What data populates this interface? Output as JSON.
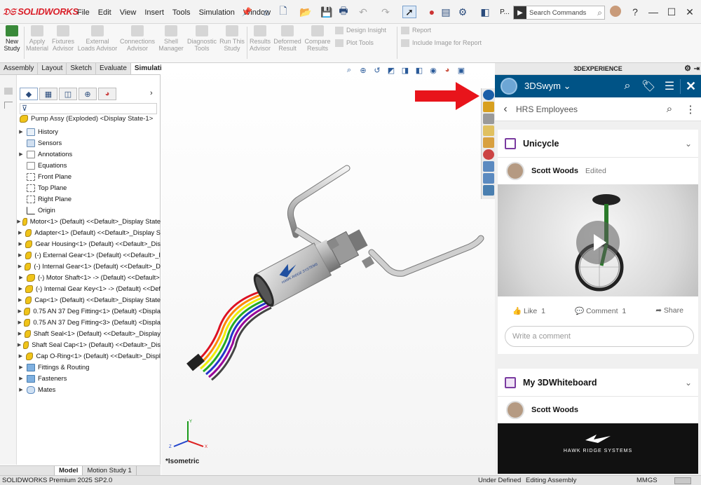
{
  "app": {
    "brand": "SOLIDWORKS"
  },
  "menu": [
    "File",
    "Edit",
    "View",
    "Insert",
    "Tools",
    "Simulation",
    "Window"
  ],
  "search": {
    "placeholder": "Search Commands"
  },
  "toolbar_overflow": "P...",
  "ribbon": {
    "buttons": [
      {
        "label": "New Study",
        "enabled": true
      },
      {
        "label": "Apply Material",
        "enabled": false
      },
      {
        "label": "Fixtures Advisor",
        "enabled": false
      },
      {
        "label": "External Loads Advisor",
        "enabled": false
      },
      {
        "label": "Connections Advisor",
        "enabled": false
      },
      {
        "label": "Shell Manager",
        "enabled": false
      },
      {
        "label": "Diagnostic Tools",
        "enabled": false
      },
      {
        "label": "Run This Study",
        "enabled": false
      },
      {
        "label": "Results Advisor",
        "enabled": false
      },
      {
        "label": "Deformed Result",
        "enabled": false
      },
      {
        "label": "Compare Results",
        "enabled": false
      }
    ],
    "small_items": [
      "Design Insight",
      "Plot Tools",
      "Report",
      "Include Image for Report"
    ]
  },
  "command_tabs": [
    "Assembly",
    "Layout",
    "Sketch",
    "Evaluate",
    "Simulation"
  ],
  "active_command_tab": "Simulation",
  "feature_tree": {
    "root": "Pump Assy (Exploded) <Display State-1>",
    "items": [
      {
        "label": "History",
        "icon": "history-icon",
        "expandable": true
      },
      {
        "label": "Sensors",
        "icon": "sensors-icon",
        "expandable": false
      },
      {
        "label": "Annotations",
        "icon": "annotations-icon",
        "expandable": true
      },
      {
        "label": "Equations",
        "icon": "equations-icon",
        "expandable": false
      },
      {
        "label": "Front Plane",
        "icon": "plane-icon",
        "expandable": false
      },
      {
        "label": "Top Plane",
        "icon": "plane-icon",
        "expandable": false
      },
      {
        "label": "Right Plane",
        "icon": "plane-icon",
        "expandable": false
      },
      {
        "label": "Origin",
        "icon": "origin-icon",
        "expandable": false
      },
      {
        "label": "Motor<1> (Default) <<Default>_Display State",
        "icon": "part-icon",
        "expandable": true
      },
      {
        "label": "Adapter<1> (Default) <<Default>_Display S",
        "icon": "part-icon",
        "expandable": true
      },
      {
        "label": "Gear Housing<1> (Default) <<Default>_Dis",
        "icon": "part-icon",
        "expandable": true
      },
      {
        "label": "(-) External Gear<1> (Default) <<Default>_I",
        "icon": "part-icon",
        "expandable": true
      },
      {
        "label": "(-) Internal Gear<1> (Default) <<Default>_D",
        "icon": "part-icon",
        "expandable": true
      },
      {
        "label": "(-) Motor Shaft<1> -> (Default) <<Default>",
        "icon": "part-icon",
        "expandable": true
      },
      {
        "label": "(-) Internal Gear Key<1> -> (Default) <<Def",
        "icon": "part-icon",
        "expandable": true
      },
      {
        "label": "Cap<1> (Default) <<Default>_Display State",
        "icon": "part-icon",
        "expandable": true
      },
      {
        "label": "0.75 AN 37 Deg Fitting<1> (Default) <Displa",
        "icon": "part-icon",
        "expandable": true
      },
      {
        "label": "0.75 AN 37 Deg Fitting<3> (Default) <Displa",
        "icon": "part-icon",
        "expandable": true
      },
      {
        "label": "Shaft Seal<1> (Default) <<Default>_Display",
        "icon": "part-icon",
        "expandable": true
      },
      {
        "label": "Shaft Seal Cap<1> (Default) <<Default>_Dis",
        "icon": "part-icon",
        "expandable": true
      },
      {
        "label": "Cap O-Ring<1> (Default) <<Default>_Displ",
        "icon": "part-icon",
        "expandable": true
      },
      {
        "label": "Fittings & Routing",
        "icon": "folder-icon",
        "expandable": true
      },
      {
        "label": "Fasteners",
        "icon": "folder-icon",
        "expandable": true
      },
      {
        "label": "Mates",
        "icon": "mates-icon",
        "expandable": true
      }
    ]
  },
  "bottom_tabs": [
    "Model",
    "Motion Study 1"
  ],
  "viewport": {
    "view_label": "*Isometric",
    "model_text": "HAWK RIDGE SYSTEMS"
  },
  "panel": {
    "header": "3DEXPERIENCE",
    "app_name": "3DSwym",
    "community": "HRS Employees",
    "cards": [
      {
        "title": "Unicycle",
        "author": "Scott Woods",
        "edited": "Edited",
        "like_label": "Like",
        "like_count": "1",
        "comment_label": "Comment",
        "comment_count": "1",
        "share_label": "Share",
        "comment_placeholder": "Write a comment"
      },
      {
        "title": "My 3DWhiteboard",
        "author": "Scott Woods",
        "banner": "HAWK RIDGE SYSTEMS"
      }
    ]
  },
  "status": {
    "product": "SOLIDWORKS Premium 2025 SP2.0",
    "state": "Under Defined",
    "mode": "Editing Assembly",
    "units": "MMGS"
  },
  "colors": {
    "brand_red": "#da1e28",
    "swym_blue": "#005386",
    "arrow_red": "#e8141b"
  }
}
